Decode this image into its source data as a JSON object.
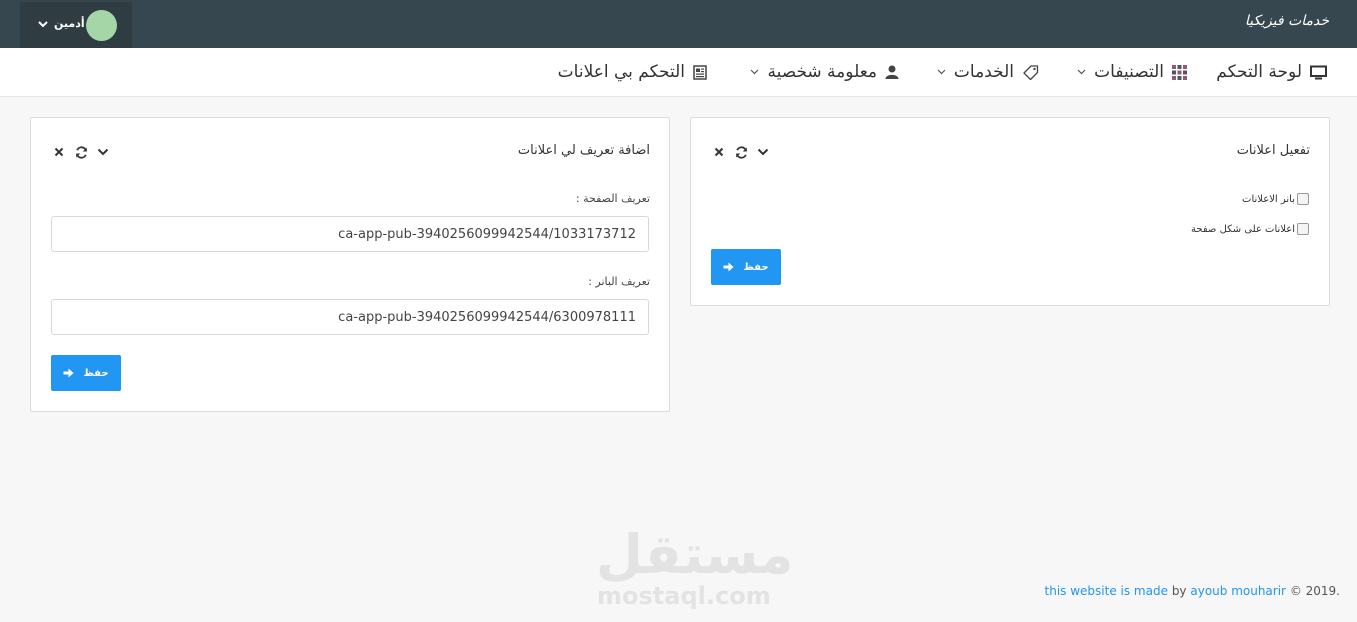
{
  "app": {
    "brand": "خدمات فيزيكيا",
    "user_name": "أدمين"
  },
  "nav": {
    "items": [
      {
        "label": "لوحة التحكم",
        "icon": "monitor-icon",
        "has_dropdown": false
      },
      {
        "label": "التصنيفات",
        "icon": "grid-icon",
        "has_dropdown": true
      },
      {
        "label": "الخدمات",
        "icon": "tag-icon",
        "has_dropdown": true
      },
      {
        "label": "معلومة شخصية",
        "icon": "user-icon",
        "has_dropdown": true
      },
      {
        "label": "التحكم بي اعلانات",
        "icon": "newspaper-icon",
        "has_dropdown": false
      }
    ]
  },
  "ads_toggle_panel": {
    "title": "تفعيل اعلانات",
    "checkboxes": [
      {
        "label": "بانر الاعلانات",
        "checked": false
      },
      {
        "label": "اعلانات على شكل صفحة",
        "checked": false
      }
    ],
    "save_label": "حفظ"
  },
  "ads_ids_panel": {
    "title": "اضافة تعريف لي اعلانات",
    "page_id_label": "تعريف الصفحة :",
    "page_id_value": "ca-app-pub-3940256099942544/1033173712",
    "banner_id_label": "تعريف البانر :",
    "banner_id_value": "ca-app-pub-3940256099942544/6300978111",
    "save_label": "حفظ"
  },
  "watermark": {
    "arabic": "مستقل",
    "latin": "mostaql.com"
  },
  "footer": {
    "copyright": "© 2019.",
    "link_text": "this website is made",
    "by_text": "by",
    "author": "ayoub mouharir"
  },
  "colors": {
    "topbar": "#37474f",
    "accent": "#2196f3",
    "avatar": "#a5d6a7"
  }
}
